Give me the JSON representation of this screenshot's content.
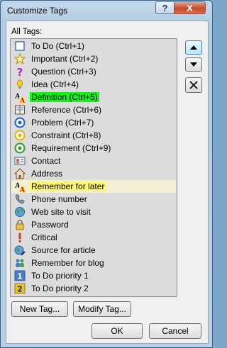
{
  "window": {
    "title": "Customize Tags",
    "help_glyph": "?",
    "close_glyph": "X"
  },
  "list_label": "All Tags:",
  "tags": [
    {
      "label": "To Do (Ctrl+1)",
      "icon": "checkbox-icon",
      "state": "normal"
    },
    {
      "label": "Important (Ctrl+2)",
      "icon": "star-icon",
      "state": "normal"
    },
    {
      "label": "Question (Ctrl+3)",
      "icon": "question-mark-icon",
      "state": "normal"
    },
    {
      "label": "Idea (Ctrl+4)",
      "icon": "lightbulb-icon",
      "state": "normal"
    },
    {
      "label": "Definition (Ctrl+5)",
      "icon": "highlighter-text-icon",
      "state": "selected"
    },
    {
      "label": "Reference (Ctrl+6)",
      "icon": "book-icon",
      "state": "normal"
    },
    {
      "label": "Problem (Ctrl+7)",
      "icon": "blue-target-icon",
      "state": "normal"
    },
    {
      "label": "Constraint (Ctrl+8)",
      "icon": "yellow-target-icon",
      "state": "normal"
    },
    {
      "label": "Requirement (Ctrl+9)",
      "icon": "green-target-icon",
      "state": "normal"
    },
    {
      "label": "Contact",
      "icon": "contact-card-icon",
      "state": "normal"
    },
    {
      "label": "Address",
      "icon": "house-icon",
      "state": "normal"
    },
    {
      "label": "Remember for later",
      "icon": "highlighter-text-icon",
      "state": "highlighted"
    },
    {
      "label": "Phone number",
      "icon": "phone-icon",
      "state": "normal"
    },
    {
      "label": "Web site to visit",
      "icon": "globe-icon",
      "state": "normal"
    },
    {
      "label": "Password",
      "icon": "padlock-icon",
      "state": "normal"
    },
    {
      "label": "Critical",
      "icon": "exclamation-icon",
      "state": "normal"
    },
    {
      "label": "Source for article",
      "icon": "globe-pen-icon",
      "state": "normal"
    },
    {
      "label": "Remember for blog",
      "icon": "people-icon",
      "state": "normal"
    },
    {
      "label": "To Do priority 1",
      "icon": "priority-1-icon",
      "state": "normal"
    },
    {
      "label": "To Do priority 2",
      "icon": "priority-2-icon",
      "state": "normal"
    }
  ],
  "buttons": {
    "move_up": "up-triangle-icon",
    "move_down": "down-triangle-icon",
    "delete": "delete-x-icon",
    "new_tag": "New Tag...",
    "modify_tag": "Modify Tag...",
    "ok": "OK",
    "cancel": "Cancel"
  },
  "colors": {
    "selected_highlight": "#12f31a",
    "yellow_highlight": "#fff67a",
    "list_background": "#dcdcdc"
  }
}
